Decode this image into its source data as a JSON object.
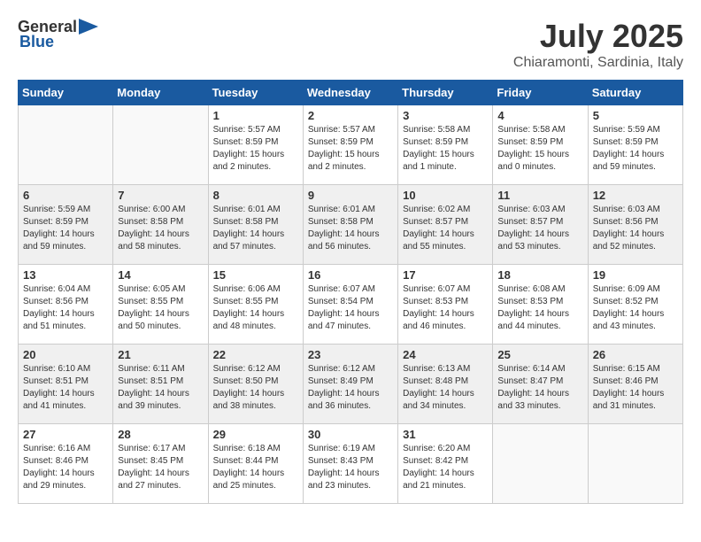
{
  "logo": {
    "text_general": "General",
    "text_blue": "Blue"
  },
  "header": {
    "month": "July 2025",
    "location": "Chiaramonti, Sardinia, Italy"
  },
  "days_of_week": [
    "Sunday",
    "Monday",
    "Tuesday",
    "Wednesday",
    "Thursday",
    "Friday",
    "Saturday"
  ],
  "weeks": [
    [
      {
        "day": "",
        "info": ""
      },
      {
        "day": "",
        "info": ""
      },
      {
        "day": "1",
        "info": "Sunrise: 5:57 AM\nSunset: 8:59 PM\nDaylight: 15 hours\nand 2 minutes."
      },
      {
        "day": "2",
        "info": "Sunrise: 5:57 AM\nSunset: 8:59 PM\nDaylight: 15 hours\nand 2 minutes."
      },
      {
        "day": "3",
        "info": "Sunrise: 5:58 AM\nSunset: 8:59 PM\nDaylight: 15 hours\nand 1 minute."
      },
      {
        "day": "4",
        "info": "Sunrise: 5:58 AM\nSunset: 8:59 PM\nDaylight: 15 hours\nand 0 minutes."
      },
      {
        "day": "5",
        "info": "Sunrise: 5:59 AM\nSunset: 8:59 PM\nDaylight: 14 hours\nand 59 minutes."
      }
    ],
    [
      {
        "day": "6",
        "info": "Sunrise: 5:59 AM\nSunset: 8:59 PM\nDaylight: 14 hours\nand 59 minutes."
      },
      {
        "day": "7",
        "info": "Sunrise: 6:00 AM\nSunset: 8:58 PM\nDaylight: 14 hours\nand 58 minutes."
      },
      {
        "day": "8",
        "info": "Sunrise: 6:01 AM\nSunset: 8:58 PM\nDaylight: 14 hours\nand 57 minutes."
      },
      {
        "day": "9",
        "info": "Sunrise: 6:01 AM\nSunset: 8:58 PM\nDaylight: 14 hours\nand 56 minutes."
      },
      {
        "day": "10",
        "info": "Sunrise: 6:02 AM\nSunset: 8:57 PM\nDaylight: 14 hours\nand 55 minutes."
      },
      {
        "day": "11",
        "info": "Sunrise: 6:03 AM\nSunset: 8:57 PM\nDaylight: 14 hours\nand 53 minutes."
      },
      {
        "day": "12",
        "info": "Sunrise: 6:03 AM\nSunset: 8:56 PM\nDaylight: 14 hours\nand 52 minutes."
      }
    ],
    [
      {
        "day": "13",
        "info": "Sunrise: 6:04 AM\nSunset: 8:56 PM\nDaylight: 14 hours\nand 51 minutes."
      },
      {
        "day": "14",
        "info": "Sunrise: 6:05 AM\nSunset: 8:55 PM\nDaylight: 14 hours\nand 50 minutes."
      },
      {
        "day": "15",
        "info": "Sunrise: 6:06 AM\nSunset: 8:55 PM\nDaylight: 14 hours\nand 48 minutes."
      },
      {
        "day": "16",
        "info": "Sunrise: 6:07 AM\nSunset: 8:54 PM\nDaylight: 14 hours\nand 47 minutes."
      },
      {
        "day": "17",
        "info": "Sunrise: 6:07 AM\nSunset: 8:53 PM\nDaylight: 14 hours\nand 46 minutes."
      },
      {
        "day": "18",
        "info": "Sunrise: 6:08 AM\nSunset: 8:53 PM\nDaylight: 14 hours\nand 44 minutes."
      },
      {
        "day": "19",
        "info": "Sunrise: 6:09 AM\nSunset: 8:52 PM\nDaylight: 14 hours\nand 43 minutes."
      }
    ],
    [
      {
        "day": "20",
        "info": "Sunrise: 6:10 AM\nSunset: 8:51 PM\nDaylight: 14 hours\nand 41 minutes."
      },
      {
        "day": "21",
        "info": "Sunrise: 6:11 AM\nSunset: 8:51 PM\nDaylight: 14 hours\nand 39 minutes."
      },
      {
        "day": "22",
        "info": "Sunrise: 6:12 AM\nSunset: 8:50 PM\nDaylight: 14 hours\nand 38 minutes."
      },
      {
        "day": "23",
        "info": "Sunrise: 6:12 AM\nSunset: 8:49 PM\nDaylight: 14 hours\nand 36 minutes."
      },
      {
        "day": "24",
        "info": "Sunrise: 6:13 AM\nSunset: 8:48 PM\nDaylight: 14 hours\nand 34 minutes."
      },
      {
        "day": "25",
        "info": "Sunrise: 6:14 AM\nSunset: 8:47 PM\nDaylight: 14 hours\nand 33 minutes."
      },
      {
        "day": "26",
        "info": "Sunrise: 6:15 AM\nSunset: 8:46 PM\nDaylight: 14 hours\nand 31 minutes."
      }
    ],
    [
      {
        "day": "27",
        "info": "Sunrise: 6:16 AM\nSunset: 8:46 PM\nDaylight: 14 hours\nand 29 minutes."
      },
      {
        "day": "28",
        "info": "Sunrise: 6:17 AM\nSunset: 8:45 PM\nDaylight: 14 hours\nand 27 minutes."
      },
      {
        "day": "29",
        "info": "Sunrise: 6:18 AM\nSunset: 8:44 PM\nDaylight: 14 hours\nand 25 minutes."
      },
      {
        "day": "30",
        "info": "Sunrise: 6:19 AM\nSunset: 8:43 PM\nDaylight: 14 hours\nand 23 minutes."
      },
      {
        "day": "31",
        "info": "Sunrise: 6:20 AM\nSunset: 8:42 PM\nDaylight: 14 hours\nand 21 minutes."
      },
      {
        "day": "",
        "info": ""
      },
      {
        "day": "",
        "info": ""
      }
    ]
  ]
}
